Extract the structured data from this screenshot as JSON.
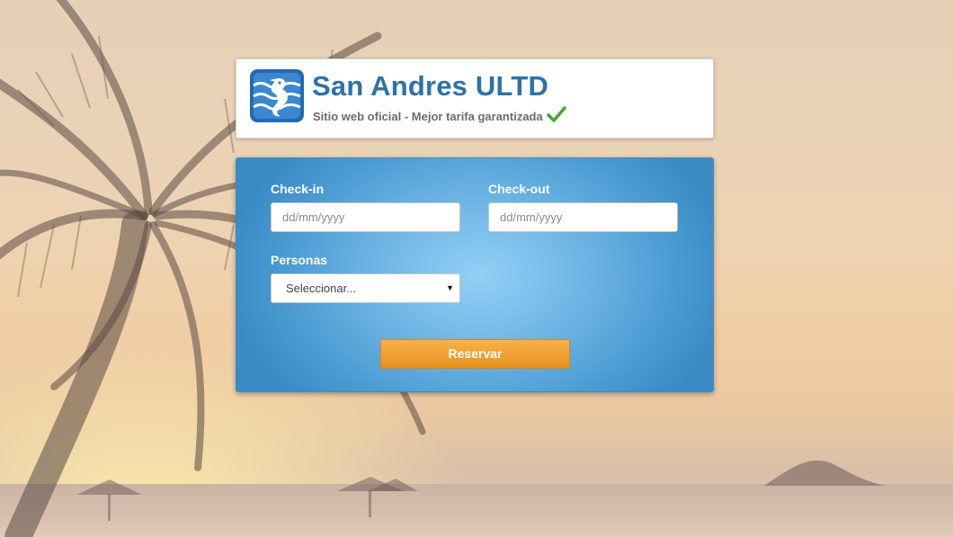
{
  "brand": {
    "title": "San Andres ULTD",
    "tagline": "Sitio web oficial - Mejor tarifa garantizada",
    "title_color": "#2d72a8",
    "logo_icon": "seahorse-icon",
    "tagline_icon": "checkmark-icon",
    "check_color": "#4aa52e"
  },
  "booking": {
    "checkin_label": "Check-in",
    "checkin_placeholder": "dd/mm/yyyy",
    "checkout_label": "Check-out",
    "checkout_placeholder": "dd/mm/yyyy",
    "persons_label": "Personas",
    "persons_selected": "Seleccionar...",
    "submit_label": "Reservar",
    "panel_color": "#4d9dd3",
    "button_color": "#f1a032"
  }
}
